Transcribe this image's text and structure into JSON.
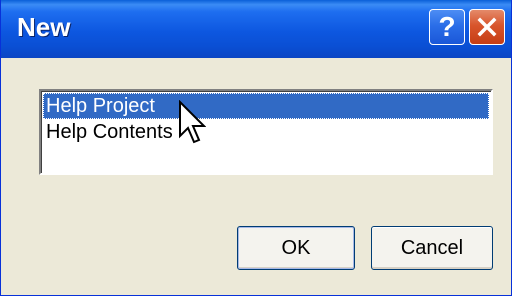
{
  "dialog": {
    "title": "New",
    "help_button": "?",
    "close_button_icon": "close-icon"
  },
  "list": {
    "items": [
      {
        "label": "Help Project",
        "selected": true
      },
      {
        "label": "Help Contents",
        "selected": false
      }
    ]
  },
  "buttons": {
    "ok_label": "OK",
    "cancel_label": "Cancel"
  },
  "colors": {
    "titlebar": "#0a4fd4",
    "selection": "#316ac5",
    "dialog_bg": "#ece9d8",
    "close_button": "#d8552c"
  }
}
